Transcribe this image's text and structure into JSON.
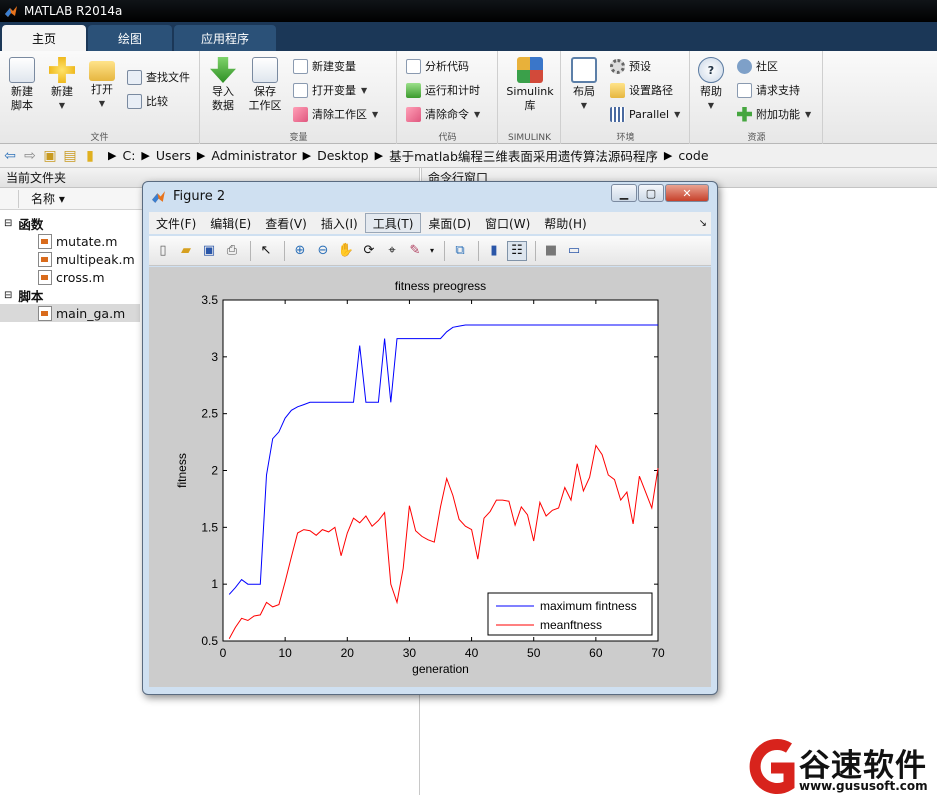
{
  "app": {
    "title": "MATLAB R2014a"
  },
  "tabs": [
    {
      "label": "主页"
    },
    {
      "label": "绘图"
    },
    {
      "label": "应用程序"
    }
  ],
  "toolstrip": {
    "file": {
      "label": "文件",
      "new_script": "新建\n脚本",
      "new": "新建",
      "open": "打开",
      "find_files": "查找文件",
      "compare": "比较"
    },
    "variable": {
      "label": "变量",
      "import": "导入\n数据",
      "save_ws": "保存\n工作区",
      "new_var": "新建变量",
      "open_var": "打开变量",
      "clear_ws": "清除工作区"
    },
    "code": {
      "label": "代码",
      "analyze": "分析代码",
      "run_time": "运行和计时",
      "clear_cmd": "清除命令"
    },
    "simulink": {
      "label": "SIMULINK",
      "btn": "Simulink\n库"
    },
    "env": {
      "label": "环境",
      "layout": "布局",
      "prefs": "预设",
      "set_path": "设置路径",
      "parallel": "Parallel"
    },
    "resources": {
      "label": "资源",
      "help": "帮助",
      "community": "社区",
      "support": "请求支持",
      "addons": "附加功能"
    }
  },
  "address": {
    "segments": [
      "C:",
      "Users",
      "Administrator",
      "Desktop",
      "基于matlab编程三维表面采用遗传算法源码程序",
      "code"
    ]
  },
  "current_folder": {
    "title": "当前文件夹",
    "col_name": "名称 ▾",
    "group_functions": "函数",
    "group_scripts": "脚本",
    "files": [
      "mutate.m",
      "multipeak.m",
      "cross.m"
    ],
    "scripts": [
      "main_ga.m"
    ]
  },
  "command_window": {
    "title": "命令行窗口"
  },
  "figure": {
    "title": "Figure 2",
    "menu": [
      "文件(F)",
      "编辑(E)",
      "查看(V)",
      "插入(I)",
      "工具(T)",
      "桌面(D)",
      "窗口(W)",
      "帮助(H)"
    ],
    "active_menu_index": 4
  },
  "chart_data": {
    "type": "line",
    "title": "fitness preogress",
    "xlabel": "generation",
    "ylabel": "fitness",
    "xlim": [
      0,
      70
    ],
    "ylim": [
      0.5,
      3.5
    ],
    "xticks": [
      0,
      10,
      20,
      30,
      40,
      50,
      60,
      70
    ],
    "yticks": [
      0.5,
      1,
      1.5,
      2,
      2.5,
      3,
      3.5
    ],
    "legend_position": "bottom-right",
    "series": [
      {
        "name": "maximum fintness",
        "color": "#0000ff",
        "x": [
          1,
          2,
          3,
          4,
          5,
          6,
          7,
          8,
          9,
          10,
          11,
          12,
          13,
          14,
          15,
          16,
          17,
          18,
          19,
          20,
          21,
          22,
          23,
          24,
          25,
          26,
          27,
          28,
          29,
          30,
          31,
          32,
          33,
          34,
          35,
          36,
          37,
          38,
          39,
          40,
          41,
          42,
          43,
          44,
          45,
          46,
          47,
          48,
          49,
          50,
          51,
          52,
          53,
          54,
          55,
          56,
          57,
          58,
          59,
          60,
          61,
          62,
          63,
          64,
          65,
          66,
          67,
          68,
          69,
          70
        ],
        "y": [
          0.91,
          0.97,
          1.04,
          1.0,
          1.0,
          1.0,
          1.96,
          2.28,
          2.34,
          2.46,
          2.53,
          2.56,
          2.58,
          2.6,
          2.6,
          2.6,
          2.6,
          2.6,
          2.6,
          2.6,
          2.6,
          3.1,
          2.6,
          2.6,
          2.6,
          3.16,
          2.6,
          3.16,
          3.16,
          3.16,
          3.16,
          3.16,
          3.16,
          3.16,
          3.16,
          3.22,
          3.26,
          3.27,
          3.28,
          3.28,
          3.28,
          3.28,
          3.28,
          3.28,
          3.28,
          3.28,
          3.28,
          3.28,
          3.28,
          3.28,
          3.28,
          3.28,
          3.28,
          3.28,
          3.28,
          3.28,
          3.28,
          3.28,
          3.28,
          3.28,
          3.28,
          3.28,
          3.28,
          3.28,
          3.28,
          3.28,
          3.28,
          3.28,
          3.28,
          3.28
        ]
      },
      {
        "name": "meanftness",
        "color": "#ff0000",
        "x": [
          1,
          2,
          3,
          4,
          5,
          6,
          7,
          8,
          9,
          10,
          11,
          12,
          13,
          14,
          15,
          16,
          17,
          18,
          19,
          20,
          21,
          22,
          23,
          24,
          25,
          26,
          27,
          28,
          29,
          30,
          31,
          32,
          33,
          34,
          35,
          36,
          37,
          38,
          39,
          40,
          41,
          42,
          43,
          44,
          45,
          46,
          47,
          48,
          49,
          50,
          51,
          52,
          53,
          54,
          55,
          56,
          57,
          58,
          59,
          60,
          61,
          62,
          63,
          64,
          65,
          66,
          67,
          68,
          69,
          70
        ],
        "y": [
          0.52,
          0.62,
          0.7,
          0.68,
          0.72,
          0.73,
          0.84,
          0.8,
          0.82,
          1.02,
          1.24,
          1.45,
          1.48,
          1.47,
          1.43,
          1.48,
          1.46,
          1.5,
          1.25,
          1.45,
          1.58,
          1.54,
          1.6,
          1.51,
          1.56,
          1.63,
          1.0,
          0.84,
          1.14,
          1.69,
          1.47,
          1.42,
          1.39,
          1.37,
          1.68,
          1.93,
          1.78,
          1.57,
          1.51,
          1.48,
          1.22,
          1.58,
          1.64,
          1.74,
          1.74,
          1.73,
          1.52,
          1.68,
          1.61,
          1.38,
          1.72,
          1.6,
          1.65,
          1.67,
          1.85,
          1.74,
          2.06,
          1.82,
          1.94,
          2.22,
          2.14,
          1.96,
          1.92,
          1.74,
          1.81,
          1.53,
          1.95,
          1.81,
          1.67,
          2.02
        ]
      }
    ]
  },
  "watermark": {
    "brand": "谷速软件",
    "url": "www.gususoft.com"
  }
}
